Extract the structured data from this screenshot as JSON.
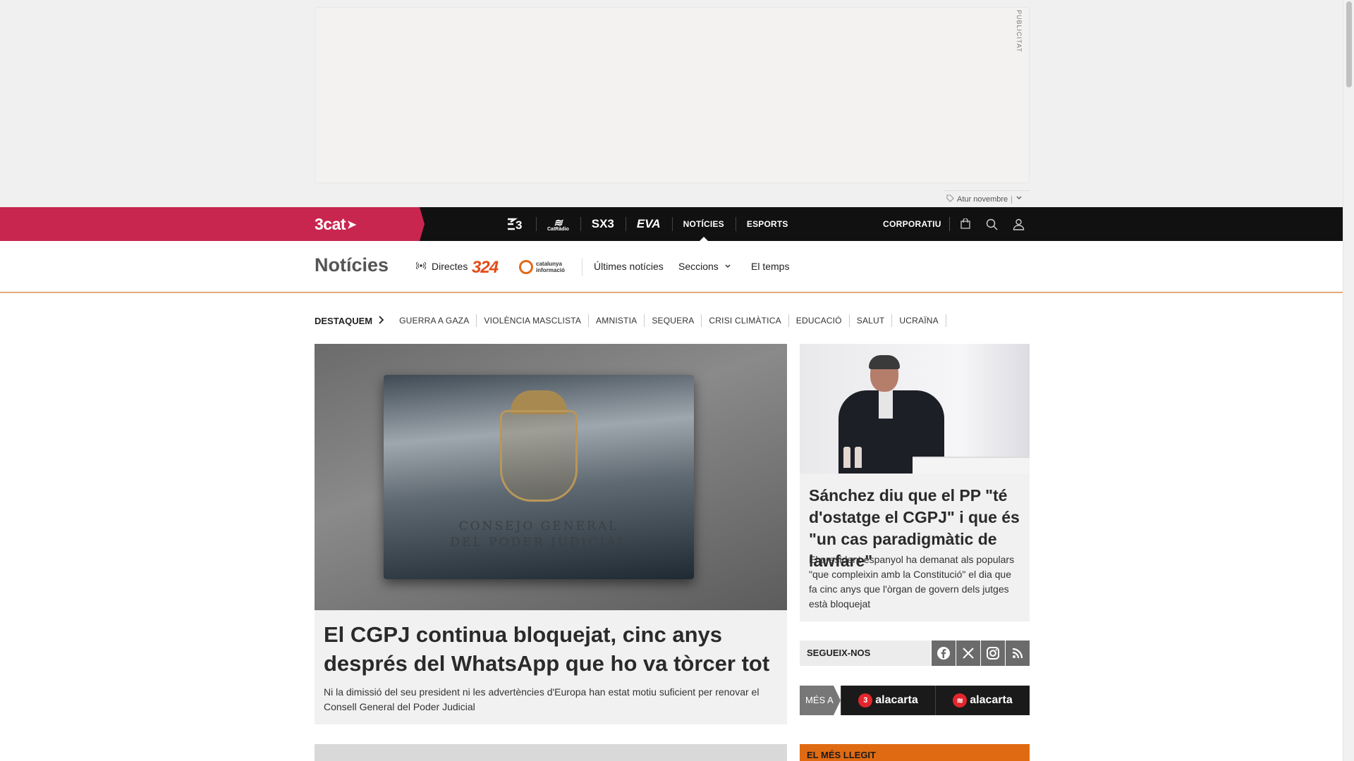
{
  "ad": {
    "label": "PUBLICITAT",
    "choice_text": "Atur novembre",
    "choice_sep": "|"
  },
  "topnav": {
    "brand": "3cat",
    "channels": [
      {
        "label": "3",
        "kind": "tv3-logo"
      },
      {
        "label": "CatRàdio",
        "kind": "catradio-logo"
      },
      {
        "label": "SX3",
        "kind": "sx3-logo"
      },
      {
        "label": "EVA",
        "kind": "eva-logo"
      },
      {
        "label": "NOTÍCIES",
        "kind": "text",
        "active": true
      },
      {
        "label": "ESPORTS",
        "kind": "text"
      }
    ],
    "corporate": "CORPORATIU"
  },
  "section": {
    "title": "Notícies",
    "directes": "Directes",
    "logo_324": "324",
    "logo_ci_line1": "catalunya",
    "logo_ci_line2": "informació",
    "links": [
      "Últimes notícies",
      "Seccions",
      "El temps"
    ]
  },
  "tags": {
    "lead": "DESTAQUEM",
    "items": [
      "GUERRA A GAZA",
      "VIOLÈNCIA MASCLISTA",
      "AMNISTIA",
      "SEQUERA",
      "CRISI CLIMÀTICA",
      "EDUCACIÓ",
      "SALUT",
      "UCRAÏNA"
    ]
  },
  "lead_article": {
    "plaque_line1": "CONSEJO GENERAL",
    "plaque_line2": "DEL PODER JUDICIAL",
    "title": "El CGPJ continua bloquejat, cinc anys després del WhatsApp que ho va tòrcer tot",
    "summary": "Ni la dimissió del seu president ni les advertències d'Europa han estat motiu suficient per renovar el Consell General del Poder Judicial"
  },
  "side_article": {
    "title": "Sánchez diu que el PP \"té d'ostatge el CGPJ\" i que és \"un cas paradigmàtic de lawfare\"",
    "summary": "El president espanyol ha demanat als populars \"que compleixin amb la Constitució\" el dia que fa cinc anys que l'òrgan de govern dels jutges està bloquejat"
  },
  "follow": {
    "label": "SEGUEIX-NOS",
    "networks": [
      "facebook-icon",
      "x-icon",
      "instagram-icon",
      "rss-icon"
    ]
  },
  "mesa": {
    "label": "MÉS A",
    "items": [
      "alacarta",
      "alacarta"
    ]
  },
  "mesllegit": {
    "label": "EL MÉS LLEGIT"
  },
  "colors": {
    "brand": "#c8264f",
    "accent": "#e06a12",
    "nav_bg": "#111111"
  }
}
